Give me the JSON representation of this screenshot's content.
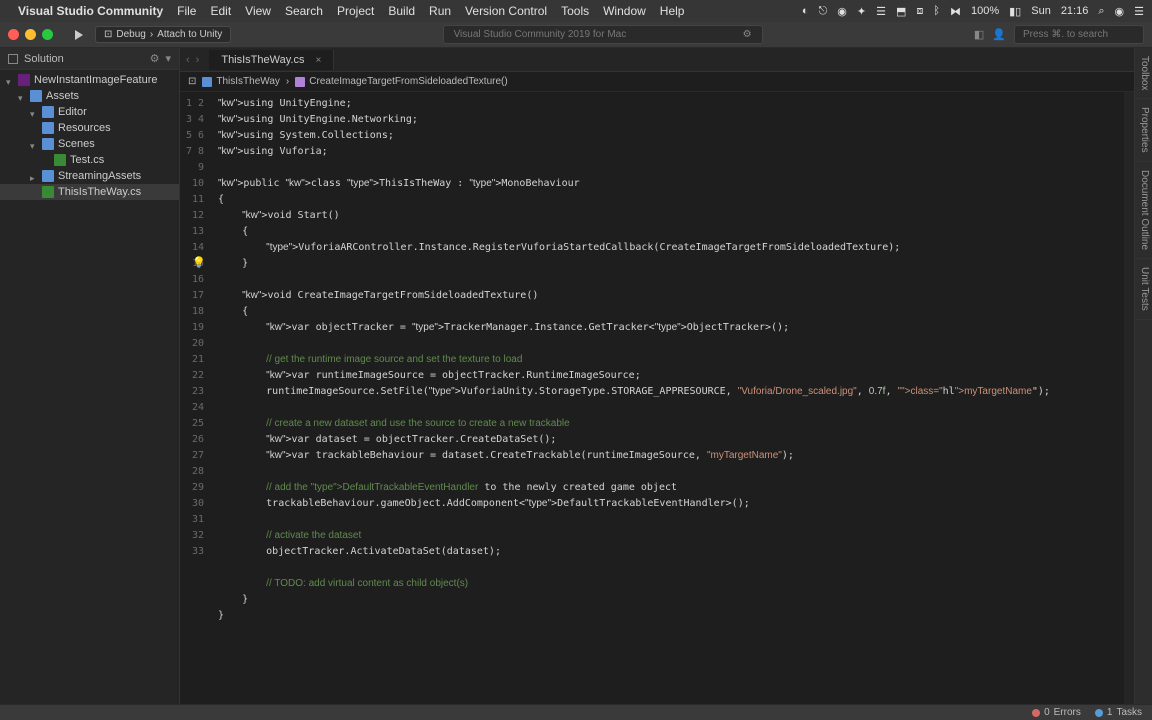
{
  "menubar": {
    "app_name": "Visual Studio Community",
    "items": [
      "File",
      "Edit",
      "View",
      "Search",
      "Project",
      "Build",
      "Run",
      "Version Control",
      "Tools",
      "Window",
      "Help"
    ],
    "battery": "100%",
    "day": "Sun",
    "time": "21:16"
  },
  "toolbar": {
    "config": "Debug",
    "target": "Attach to Unity",
    "center_text": "Visual Studio Community 2019 for Mac",
    "right_search_placeholder": "Press ⌘. to search"
  },
  "solution": {
    "title": "Solution",
    "tree": [
      {
        "lvl": 0,
        "disclosure": "open",
        "icon": "proj",
        "label": "NewInstantImageFeature"
      },
      {
        "lvl": 1,
        "disclosure": "open",
        "icon": "folder",
        "label": "Assets"
      },
      {
        "lvl": 2,
        "disclosure": "open",
        "icon": "folder",
        "label": "Editor"
      },
      {
        "lvl": 2,
        "disclosure": "",
        "icon": "folder",
        "label": "Resources"
      },
      {
        "lvl": 2,
        "disclosure": "open",
        "icon": "folder",
        "label": "Scenes"
      },
      {
        "lvl": 3,
        "disclosure": "",
        "icon": "cs",
        "label": "Test.cs"
      },
      {
        "lvl": 2,
        "disclosure": "closed",
        "icon": "folder",
        "label": "StreamingAssets"
      },
      {
        "lvl": 2,
        "disclosure": "",
        "icon": "cs",
        "label": "ThisIsTheWay.cs",
        "selected": true
      }
    ]
  },
  "tabs": {
    "file_tab": "ThisIsTheWay.cs",
    "breadcrumb_class": "ThisIsTheWay",
    "breadcrumb_method": "CreateImageTargetFromSideloadedTexture()"
  },
  "side_tabs": [
    "Toolbox",
    "Properties",
    "Document Outline",
    "Unit Tests"
  ],
  "code": {
    "lines": [
      "using UnityEngine;",
      "using UnityEngine.Networking;",
      "using System.Collections;",
      "using Vuforia;",
      "",
      "public class ThisIsTheWay : MonoBehaviour",
      "{",
      "    void Start()",
      "    {",
      "        VuforiaARController.Instance.RegisterVuforiaStartedCallback(CreateImageTargetFromSideloadedTexture);",
      "    }",
      "",
      "    void CreateImageTargetFromSideloadedTexture()",
      "    {",
      "        var objectTracker = TrackerManager.Instance.GetTracker<ObjectTracker>();",
      "",
      "        // get the runtime image source and set the texture to load",
      "        var runtimeImageSource = objectTracker.RuntimeImageSource;",
      "        runtimeImageSource.SetFile(VuforiaUnity.StorageType.STORAGE_APPRESOURCE, \"Vuforia/Drone_scaled.jpg\", 0.7f, \"myTargetName\");",
      "",
      "        // create a new dataset and use the source to create a new trackable",
      "        var dataset = objectTracker.CreateDataSet();",
      "        var trackableBehaviour = dataset.CreateTrackable(runtimeImageSource, \"myTargetName\");",
      "",
      "        // add the DefaultTrackableEventHandler to the newly created game object",
      "        trackableBehaviour.gameObject.AddComponent<DefaultTrackableEventHandler>();",
      "",
      "        // activate the dataset",
      "        objectTracker.ActivateDataSet(dataset);",
      "",
      "        // TODO: add virtual content as child object(s)",
      "    }",
      "}"
    ]
  },
  "statusbar": {
    "errors_label": "Errors",
    "errors_count": "0",
    "tasks_label": "Tasks",
    "tasks_count": "1"
  }
}
